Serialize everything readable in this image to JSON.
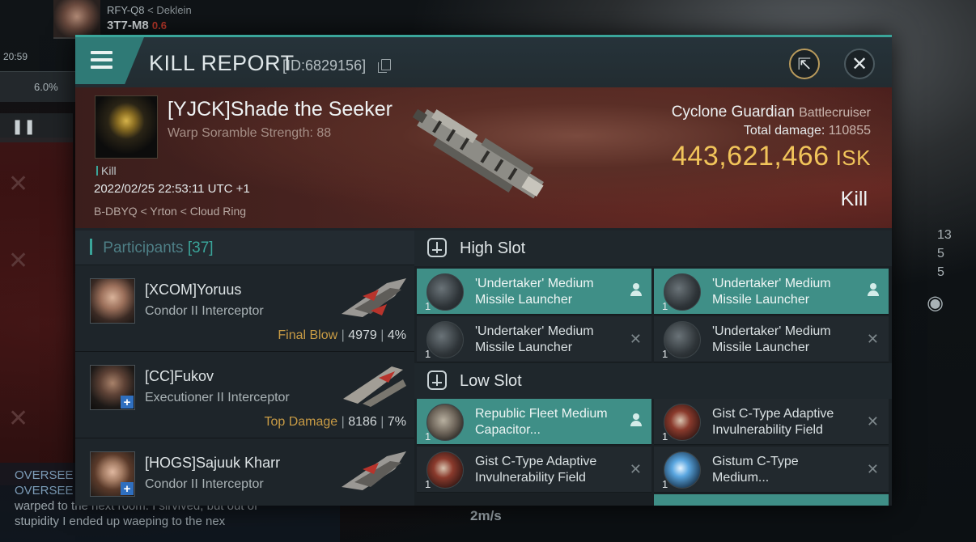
{
  "hud": {
    "pilot_system_left": "RFY-Q8",
    "pilot_system_right": "< Deklein",
    "current_system": "3T7-M8",
    "security": "0.6",
    "clock": "20:59",
    "cargo_percent": "6.0%",
    "counters": [
      "13",
      "5",
      "5"
    ],
    "speed": "2m/s",
    "chat_lines": [
      {
        "type": "channel",
        "text": "OVERSEE"
      },
      {
        "type": "channel",
        "text": "OVERSEE"
      },
      {
        "type": "msg",
        "text": "warped to the next room. I sirvived, but out of"
      },
      {
        "type": "msg",
        "text": "stupidity I ended up waeping to the nex"
      }
    ]
  },
  "window": {
    "title": "KILL REPORT",
    "id_label": "[ID:6829156]",
    "share_glyph": "⇱",
    "close_glyph": "✕"
  },
  "victim": {
    "name": "[YJCK]Shade the Seeker",
    "warp_scramble": "Warp Soramble Strength: 88",
    "kill_tag": "Kill",
    "datetime": "2022/02/25 22:53:11 UTC +1",
    "location": "B-DBYQ < Yrton < Cloud Ring",
    "ship_name": "Cyclone Guardian",
    "ship_class": "Battlecruiser",
    "total_damage_label": "Total damage:",
    "total_damage": "110855",
    "isk_value": "443,621,466",
    "isk_unit": "ISK",
    "result": "Kill"
  },
  "participants": {
    "label": "Participants",
    "count": "[37]",
    "rows": [
      {
        "name": "[XCOM]Yoruus",
        "ship": "Condor II Interceptor",
        "role": "Final Blow",
        "damage": "4979",
        "percent": "4%",
        "plus": ""
      },
      {
        "name": "[CC]Fukov",
        "ship": "Executioner II Interceptor",
        "role": "Top Damage",
        "damage": "8186",
        "percent": "7%",
        "plus": "+"
      },
      {
        "name": "[HOGS]Sajuuk Kharr",
        "ship": "Condor II Interceptor",
        "role": "",
        "damage": "",
        "percent": "",
        "plus": "+"
      }
    ]
  },
  "slots": {
    "high": {
      "label": "High Slot",
      "modules": [
        {
          "name": "'Undertaker' Medium Missile Launcher",
          "qty": "1",
          "status": "dropped",
          "icon": "missile-launcher-icon"
        },
        {
          "name": "'Undertaker' Medium Missile Launcher",
          "qty": "1",
          "status": "dropped",
          "icon": "missile-launcher-icon"
        },
        {
          "name": "'Undertaker' Medium Missile Launcher",
          "qty": "1",
          "status": "destroyed",
          "icon": "missile-launcher-icon"
        },
        {
          "name": "'Undertaker' Medium Missile Launcher",
          "qty": "1",
          "status": "destroyed",
          "icon": "missile-launcher-icon"
        }
      ]
    },
    "low": {
      "label": "Low Slot",
      "modules": [
        {
          "name": "Republic Fleet Medium Capacitor...",
          "qty": "1",
          "status": "dropped",
          "icon": "capacitor-booster-icon"
        },
        {
          "name": "Gist C-Type Adaptive Invulnerability Field",
          "qty": "1",
          "status": "destroyed",
          "icon": "invulnerability-field-icon"
        },
        {
          "name": "Gist C-Type Adaptive Invulnerability Field",
          "qty": "1",
          "status": "destroyed",
          "icon": "invulnerability-field-icon"
        },
        {
          "name": "Gistum C-Type Medium...",
          "qty": "1",
          "status": "destroyed",
          "icon": "shield-extender-icon"
        }
      ]
    },
    "status_glyph_destroyed": "✕"
  }
}
